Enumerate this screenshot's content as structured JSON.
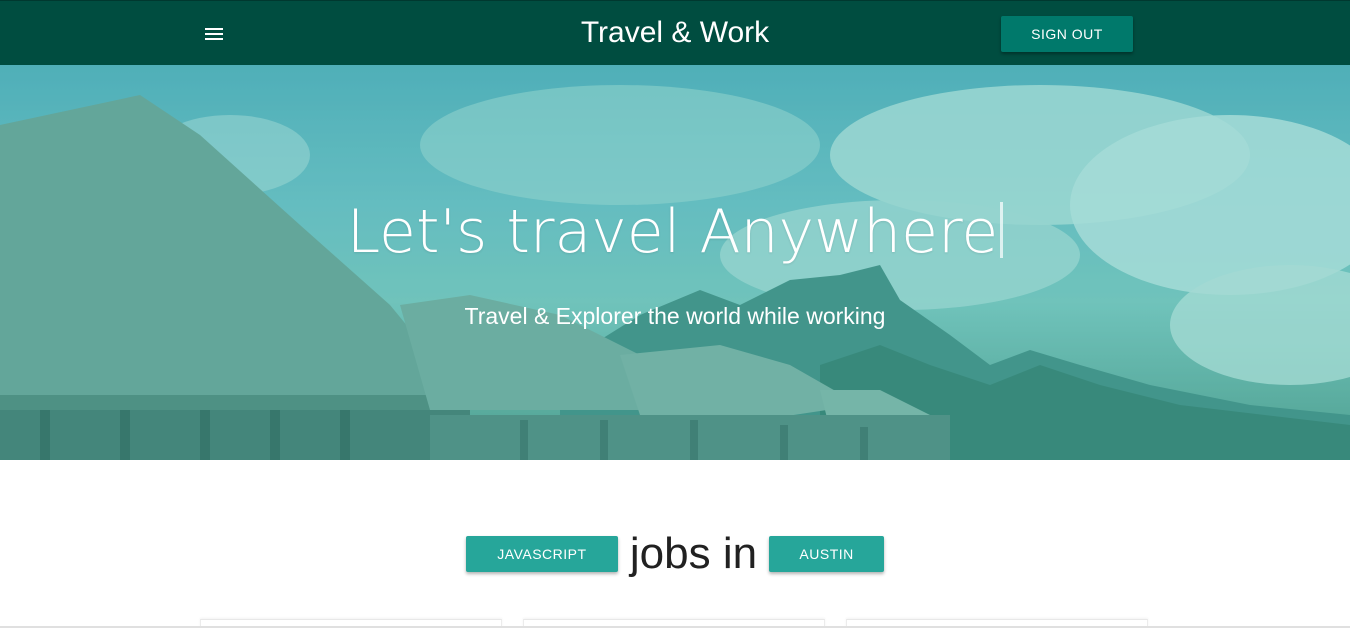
{
  "navbar": {
    "title": "Travel & Work",
    "menu_icon": "hamburger-menu-icon",
    "signout_label": "SIGN OUT",
    "background": "#004d40",
    "button_color": "#00796b"
  },
  "hero": {
    "title": "Let's travel Anywhere",
    "subtitle": "Travel & Explorer the world while working",
    "overlay_color": "#26a69a"
  },
  "jobs_search": {
    "technology_label": "JAVASCRIPT",
    "connector_text": "jobs in",
    "location_label": "AUSTIN",
    "button_color": "#26a69a"
  }
}
